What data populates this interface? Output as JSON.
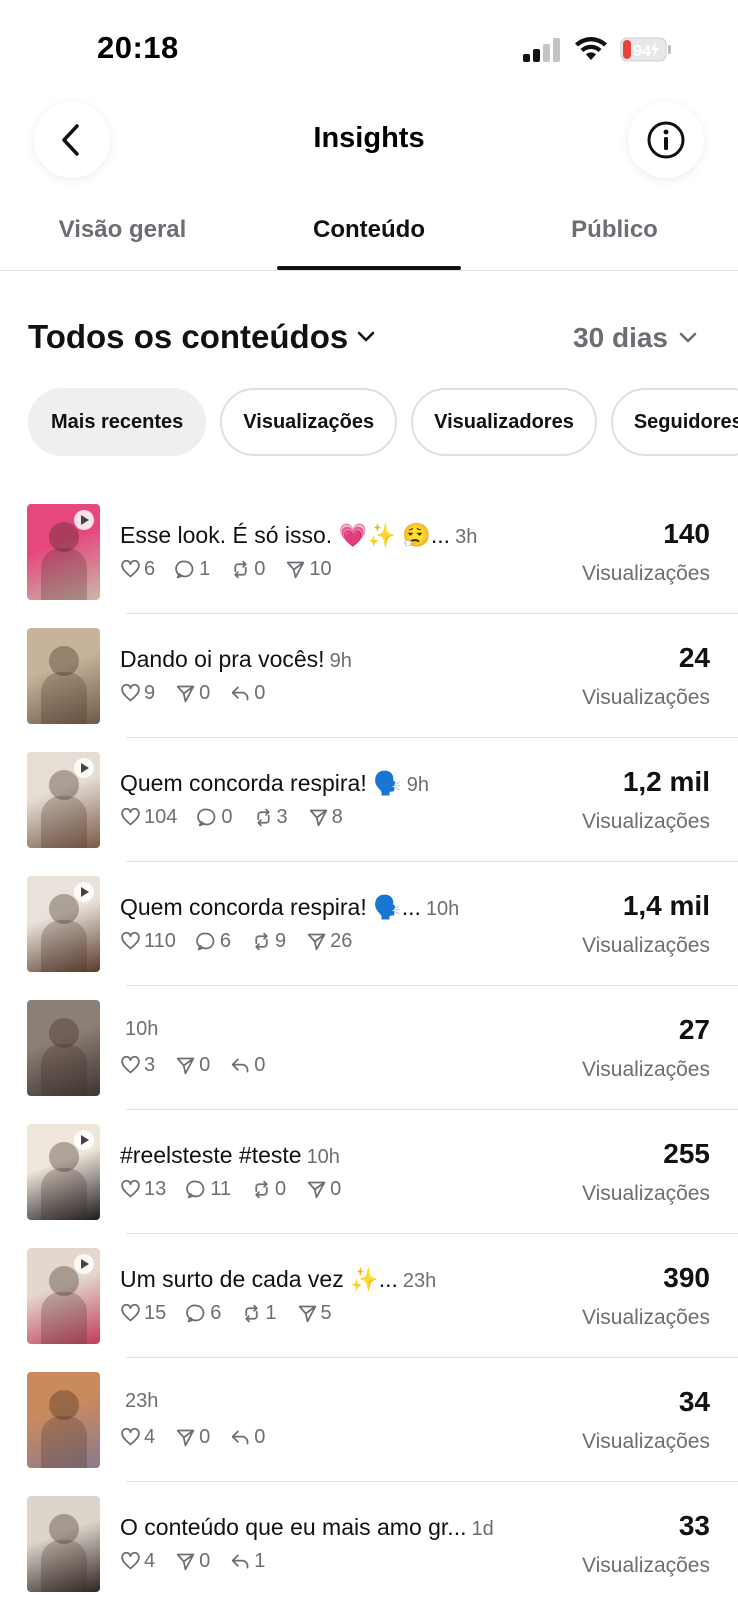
{
  "status_bar": {
    "time": "20:18",
    "battery": "94"
  },
  "header": {
    "title": "Insights",
    "back_icon": "chevron-left-icon",
    "info_icon": "info-icon"
  },
  "tabs": [
    {
      "label": "Visão geral",
      "active": false
    },
    {
      "label": "Conteúdo",
      "active": true
    },
    {
      "label": "Público",
      "active": false
    }
  ],
  "section": {
    "title": "Todos os conteúdos",
    "range": "30 dias"
  },
  "chips": [
    "Mais recentes",
    "Visualizações",
    "Visualizadores",
    "Seguidores"
  ],
  "views_label": "Visualizações",
  "items": [
    {
      "caption": "Esse look. É só isso. 💗✨ 😮‍💨...",
      "age": "3h",
      "views": "140",
      "stats": [
        {
          "icon": "heart-icon",
          "value": "6"
        },
        {
          "icon": "comment-icon",
          "value": "1"
        },
        {
          "icon": "repost-icon",
          "value": "0"
        },
        {
          "icon": "send-icon",
          "value": "10"
        }
      ],
      "thumb_colors": [
        "#e6477c",
        "#c9b8a8"
      ],
      "video": true
    },
    {
      "caption": "Dando oi pra vocês!",
      "age": "9h",
      "views": "24",
      "stats": [
        {
          "icon": "heart-icon",
          "value": "9"
        },
        {
          "icon": "send-icon",
          "value": "0"
        },
        {
          "icon": "reply-icon",
          "value": "0"
        }
      ],
      "thumb_colors": [
        "#c7b39a",
        "#6f5a48"
      ],
      "video": false
    },
    {
      "caption": "Quem concorda respira! 🗣️",
      "age": "9h",
      "views": "1,2 mil",
      "stats": [
        {
          "icon": "heart-icon",
          "value": "104"
        },
        {
          "icon": "comment-icon",
          "value": "0"
        },
        {
          "icon": "repost-icon",
          "value": "3"
        },
        {
          "icon": "send-icon",
          "value": "8"
        }
      ],
      "thumb_colors": [
        "#e6ddd4",
        "#7a5a45"
      ],
      "video": true
    },
    {
      "caption": "Quem concorda respira! 🗣️...",
      "age": "10h",
      "views": "1,4 mil",
      "stats": [
        {
          "icon": "heart-icon",
          "value": "110"
        },
        {
          "icon": "comment-icon",
          "value": "6"
        },
        {
          "icon": "repost-icon",
          "value": "9"
        },
        {
          "icon": "send-icon",
          "value": "26"
        }
      ],
      "thumb_colors": [
        "#e9e2da",
        "#5a3a2a"
      ],
      "video": true
    },
    {
      "caption": "",
      "age": "10h",
      "views": "27",
      "stats": [
        {
          "icon": "heart-icon",
          "value": "3"
        },
        {
          "icon": "send-icon",
          "value": "0"
        },
        {
          "icon": "reply-icon",
          "value": "0"
        }
      ],
      "thumb_colors": [
        "#8c7f76",
        "#3e3430"
      ],
      "video": false
    },
    {
      "caption": "#reelsteste #teste",
      "age": "10h",
      "views": "255",
      "stats": [
        {
          "icon": "heart-icon",
          "value": "13"
        },
        {
          "icon": "comment-icon",
          "value": "11"
        },
        {
          "icon": "repost-icon",
          "value": "0"
        },
        {
          "icon": "send-icon",
          "value": "0"
        }
      ],
      "thumb_colors": [
        "#efe6dc",
        "#1c1a1c"
      ],
      "video": true
    },
    {
      "caption": "Um surto de cada vez ✨...",
      "age": "23h",
      "views": "390",
      "stats": [
        {
          "icon": "heart-icon",
          "value": "15"
        },
        {
          "icon": "comment-icon",
          "value": "6"
        },
        {
          "icon": "repost-icon",
          "value": "1"
        },
        {
          "icon": "send-icon",
          "value": "5"
        }
      ],
      "thumb_colors": [
        "#e4d8ce",
        "#c23b5a"
      ],
      "video": true
    },
    {
      "caption": "",
      "age": "23h",
      "views": "34",
      "stats": [
        {
          "icon": "heart-icon",
          "value": "4"
        },
        {
          "icon": "send-icon",
          "value": "0"
        },
        {
          "icon": "reply-icon",
          "value": "0"
        }
      ],
      "thumb_colors": [
        "#c98a5e",
        "#8a7a90"
      ],
      "video": false
    },
    {
      "caption": "O conteúdo que eu mais amo gr...",
      "age": "1d",
      "views": "33",
      "stats": [
        {
          "icon": "heart-icon",
          "value": "4"
        },
        {
          "icon": "send-icon",
          "value": "0"
        },
        {
          "icon": "reply-icon",
          "value": "1"
        }
      ],
      "thumb_colors": [
        "#ddd5cc",
        "#2e2420"
      ],
      "video": false
    }
  ]
}
